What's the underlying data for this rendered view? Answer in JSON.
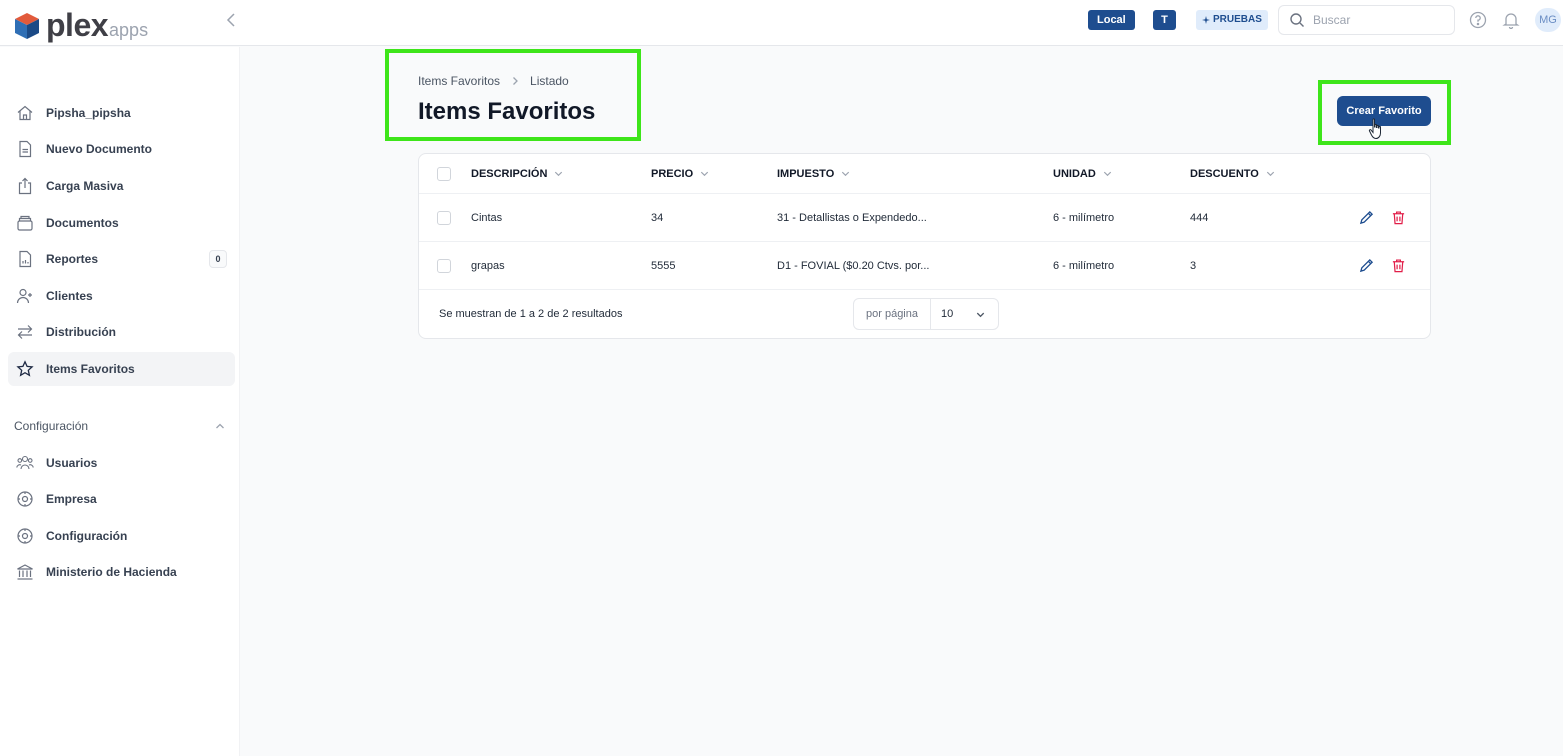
{
  "header": {
    "logo_main": "plex",
    "logo_sub": "apps",
    "badge_local": "Local",
    "badge_t": "T",
    "badge_pruebas": "PRUEBAS",
    "search_placeholder": "Buscar",
    "avatar_initials": "MG"
  },
  "sidebar": {
    "items": [
      {
        "label": "Pipsha_pipsha",
        "icon": "home-icon"
      },
      {
        "label": "Nuevo Documento",
        "icon": "document-icon"
      },
      {
        "label": "Carga Masiva",
        "icon": "upload-icon"
      },
      {
        "label": "Documentos",
        "icon": "archive-icon"
      },
      {
        "label": "Reportes",
        "icon": "report-icon",
        "count": "0"
      },
      {
        "label": "Clientes",
        "icon": "user-plus-icon"
      },
      {
        "label": "Distribución",
        "icon": "arrows-icon"
      },
      {
        "label": "Items Favoritos",
        "icon": "star-icon",
        "active": true
      }
    ],
    "config_section_title": "Configuración",
    "config_items": [
      {
        "label": "Usuarios",
        "icon": "users-icon"
      },
      {
        "label": "Empresa",
        "icon": "building-gear-icon"
      },
      {
        "label": "Configuración",
        "icon": "settings-icon"
      },
      {
        "label": "Ministerio de Hacienda",
        "icon": "bank-icon"
      }
    ]
  },
  "main": {
    "breadcrumb": [
      "Items Favoritos",
      "Listado"
    ],
    "title": "Items Favoritos",
    "create_button": "Crear Favorito",
    "table": {
      "columns": [
        "DESCRIPCIÓN",
        "PRECIO",
        "IMPUESTO",
        "UNIDAD",
        "DESCUENTO"
      ],
      "rows": [
        [
          "Cintas",
          "34",
          "31 - Detallistas o Expendedo...",
          "6 - milímetro",
          "444"
        ],
        [
          "grapas",
          "5555",
          "D1 - FOVIAL ($0.20 Ctvs. por...",
          "6 - milímetro",
          "3"
        ]
      ],
      "results_text": "Se muestran de 1 a 2 de 2 resultados",
      "per_page_label": "por página",
      "per_page_value": "10"
    }
  },
  "colors": {
    "primary": "#1e4d8f",
    "highlight": "#3ee51a",
    "delete": "#e11d48",
    "edit": "#1e4d8f"
  }
}
